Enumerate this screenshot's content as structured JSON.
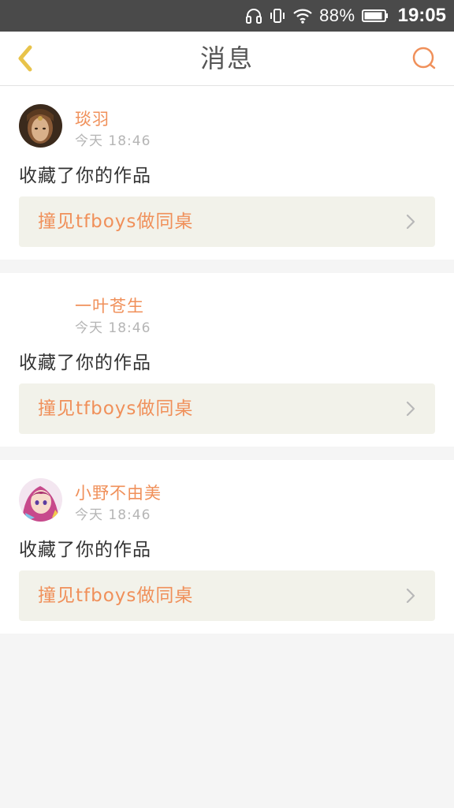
{
  "status_bar": {
    "battery_percent": "88%",
    "time": "19:05",
    "icons": [
      "headphones-icon",
      "vibrate-icon",
      "wifi-icon",
      "battery-icon"
    ]
  },
  "header": {
    "title": "消息",
    "back_icon": "chevron-left-icon",
    "search_icon": "search-icon"
  },
  "colors": {
    "accent": "#f0905a",
    "back_arrow": "#e8c34a",
    "card_link_bg": "#f2f2ea",
    "page_bg": "#f5f5f5"
  },
  "messages": [
    {
      "username": "琰羽",
      "time": "今天 18:46",
      "action": "收藏了你的作品",
      "work_title": "撞见tfboys做同桌",
      "avatar": "avatar-icon"
    },
    {
      "username": "一叶苍生",
      "time": "今天 18:46",
      "action": "收藏了你的作品",
      "work_title": "撞见tfboys做同桌",
      "avatar": ""
    },
    {
      "username": "小野不由美",
      "time": "今天 18:46",
      "action": "收藏了你的作品",
      "work_title": "撞见tfboys做同桌",
      "avatar": "avatar-icon"
    }
  ]
}
